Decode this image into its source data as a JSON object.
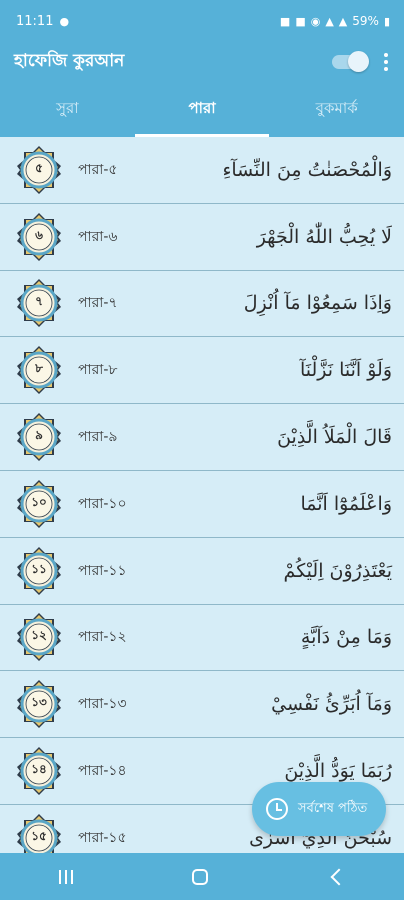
{
  "status": {
    "time": "11:11",
    "battery": "59%"
  },
  "app": {
    "title": "হাফেজি কুরআন"
  },
  "tabs": [
    {
      "label": "সুরা"
    },
    {
      "label": "পারা"
    },
    {
      "label": "বুকমার্ক"
    }
  ],
  "paras": [
    {
      "num": "৫",
      "label": "পারা-৫",
      "arabic": "وَالْمُحْصَنٰتُ مِنَ النِّسَآءِ"
    },
    {
      "num": "৬",
      "label": "পারা-৬",
      "arabic": "لَا يُحِبُّ اللّٰهُ الْجَهْرَ"
    },
    {
      "num": "৭",
      "label": "পারা-৭",
      "arabic": "وَاِذَا سَمِعُوْا مَآ اُنْزِلَ"
    },
    {
      "num": "৮",
      "label": "পারা-৮",
      "arabic": "وَلَوْ اَنَّنَا نَزَّلْنَآ"
    },
    {
      "num": "৯",
      "label": "পারা-৯",
      "arabic": "قَالَ الْمَلَاُ الَّذِيْنَ"
    },
    {
      "num": "১০",
      "label": "পারা-১০",
      "arabic": "وَاعْلَمُوْٓا اَنَّمَا"
    },
    {
      "num": "১১",
      "label": "পারা-১১",
      "arabic": "يَعْتَذِرُوْنَ اِلَيْكُمْ"
    },
    {
      "num": "১২",
      "label": "পারা-১২",
      "arabic": "وَمَا مِنْ دَآبَّةٍ"
    },
    {
      "num": "১৩",
      "label": "পারা-১৩",
      "arabic": "وَمَآ اُبَرِّئُ نَفْسِيْ"
    },
    {
      "num": "১৪",
      "label": "পারা-১৪",
      "arabic": "رُبَمَا يَوَدُّ الَّذِيْنَ"
    },
    {
      "num": "১৫",
      "label": "পারা-১৫",
      "arabic": "سُبْحٰنَ الَّذِيْٓ اَسْرٰى"
    }
  ],
  "fab": {
    "label": "সর্বশেষ পঠিত"
  }
}
